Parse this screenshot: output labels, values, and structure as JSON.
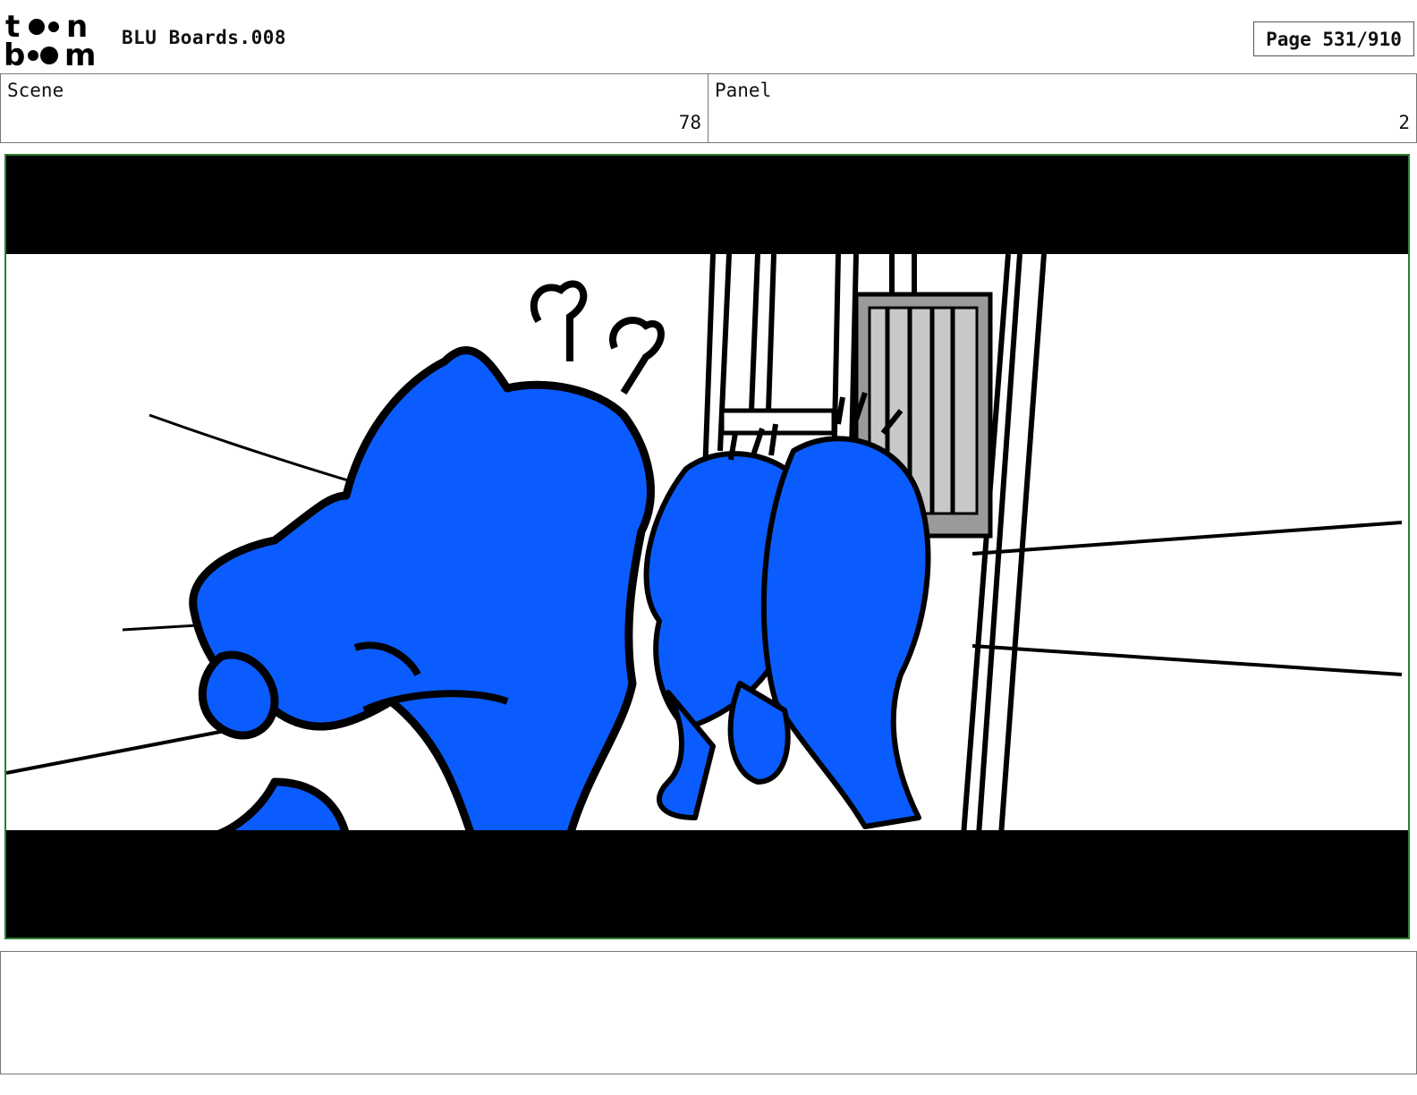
{
  "header": {
    "logo_text": "toon boom",
    "document_title": "BLU Boards.008",
    "page_label": "Page 531/910"
  },
  "info": {
    "scene_label": "Scene",
    "scene_value": "78",
    "panel_label": "Panel",
    "panel_value": "2"
  },
  "panel_image": {
    "description_icon": "storyboard-drawing",
    "colors": {
      "character_fill": "#0a5cff",
      "letterbox": "#000000",
      "frame_border": "#2e7d32",
      "door_gray": "#9a9a9a"
    }
  },
  "notes": {
    "text": ""
  }
}
